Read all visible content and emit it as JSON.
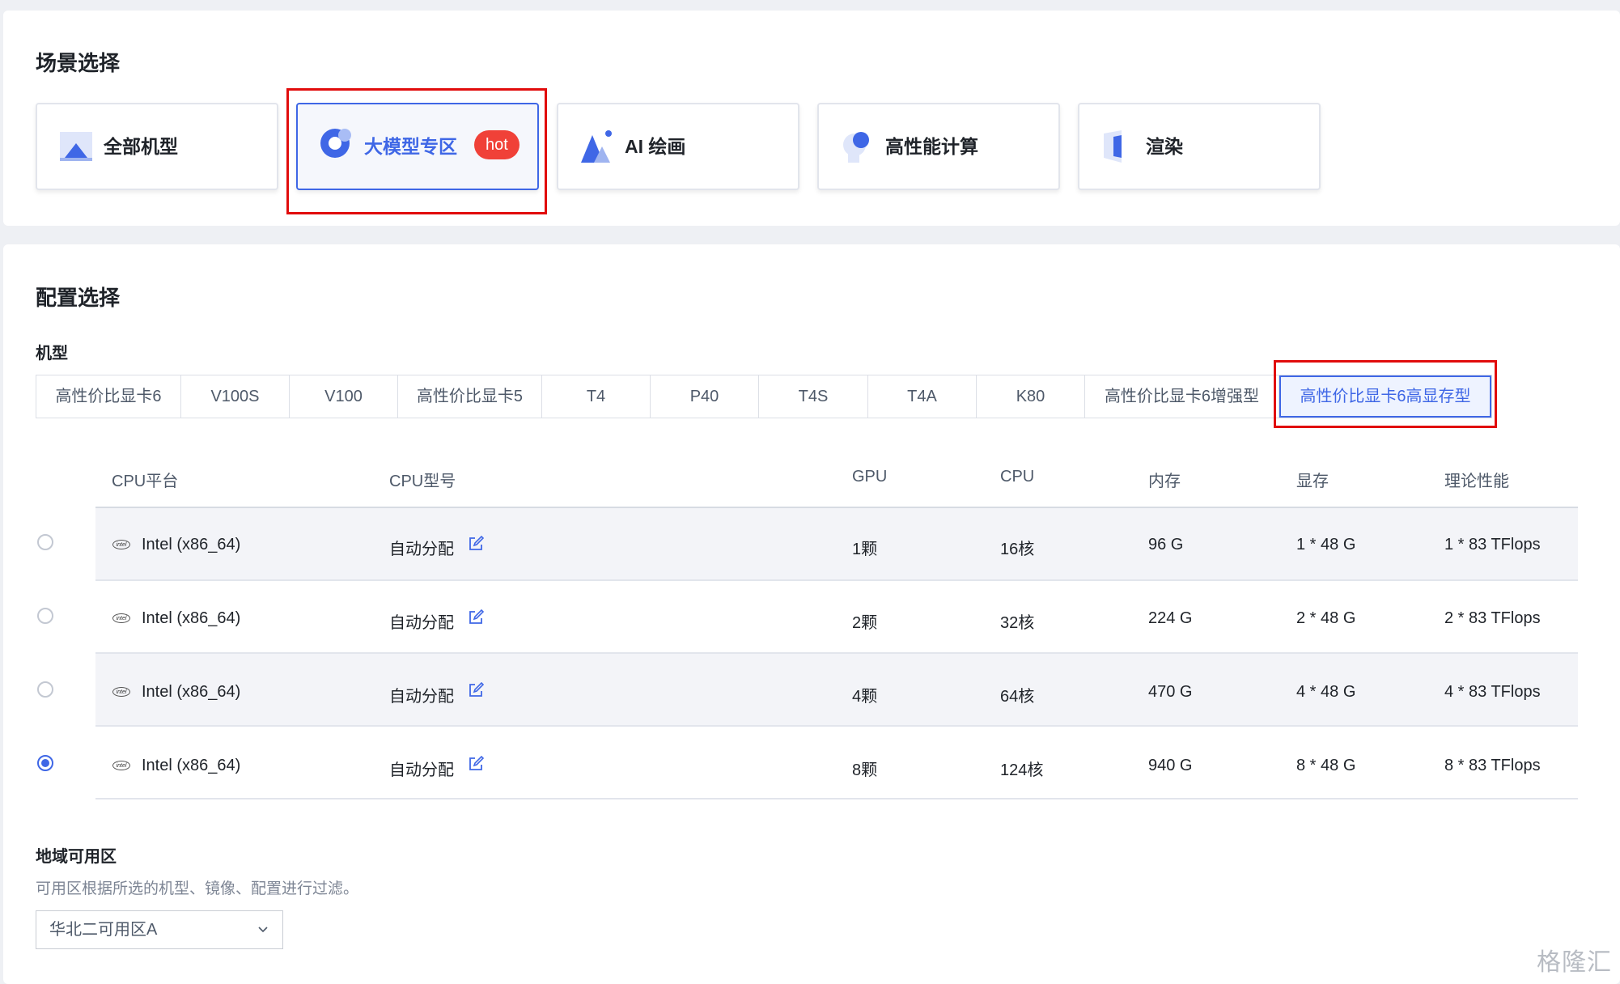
{
  "scene": {
    "title": "场景选择",
    "cards": [
      {
        "label": "全部机型",
        "icon": "all-models-icon"
      },
      {
        "label": "大模型专区",
        "icon": "large-model-icon",
        "badge": "hot",
        "selected": true
      },
      {
        "label": "AI 绘画",
        "icon": "ai-painting-icon"
      },
      {
        "label": "高性能计算",
        "icon": "hpc-icon"
      },
      {
        "label": "渲染",
        "icon": "render-icon"
      }
    ]
  },
  "config": {
    "title": "配置选择",
    "model_label": "机型",
    "tabs": [
      "高性价比显卡6",
      "V100S",
      "V100",
      "高性价比显卡5",
      "T4",
      "P40",
      "T4S",
      "T4A",
      "K80",
      "高性价比显卡6增强型",
      "高性价比显卡6高显存型"
    ],
    "selected_tab": "高性价比显卡6高显存型",
    "columns": [
      "CPU平台",
      "CPU型号",
      "GPU",
      "CPU",
      "内存",
      "显存",
      "理论性能"
    ],
    "rows": [
      {
        "platform": "Intel (x86_64)",
        "model": "自动分配",
        "gpu": "1颗",
        "cpu": "16核",
        "mem": "96 G",
        "vram": "1 * 48 G",
        "perf": "1 * 83 TFlops",
        "selected": false
      },
      {
        "platform": "Intel (x86_64)",
        "model": "自动分配",
        "gpu": "2颗",
        "cpu": "32核",
        "mem": "224 G",
        "vram": "2 * 48 G",
        "perf": "2 * 83 TFlops",
        "selected": false
      },
      {
        "platform": "Intel (x86_64)",
        "model": "自动分配",
        "gpu": "4颗",
        "cpu": "64核",
        "mem": "470 G",
        "vram": "4 * 48 G",
        "perf": "4 * 83 TFlops",
        "selected": false
      },
      {
        "platform": "Intel (x86_64)",
        "model": "自动分配",
        "gpu": "8颗",
        "cpu": "124核",
        "mem": "940 G",
        "vram": "8 * 48 G",
        "perf": "8 * 83 TFlops",
        "selected": true
      }
    ],
    "intel_logo_text": "intel",
    "region": {
      "label": "地域可用区",
      "hint": "可用区根据所选的机型、镜像、配置进行过滤。",
      "selected": "华北二可用区A"
    }
  },
  "watermark": "格隆汇",
  "colors": {
    "accent": "#3f67e6",
    "hot_badge": "#f04138",
    "highlight_box": "#e10c0c"
  }
}
